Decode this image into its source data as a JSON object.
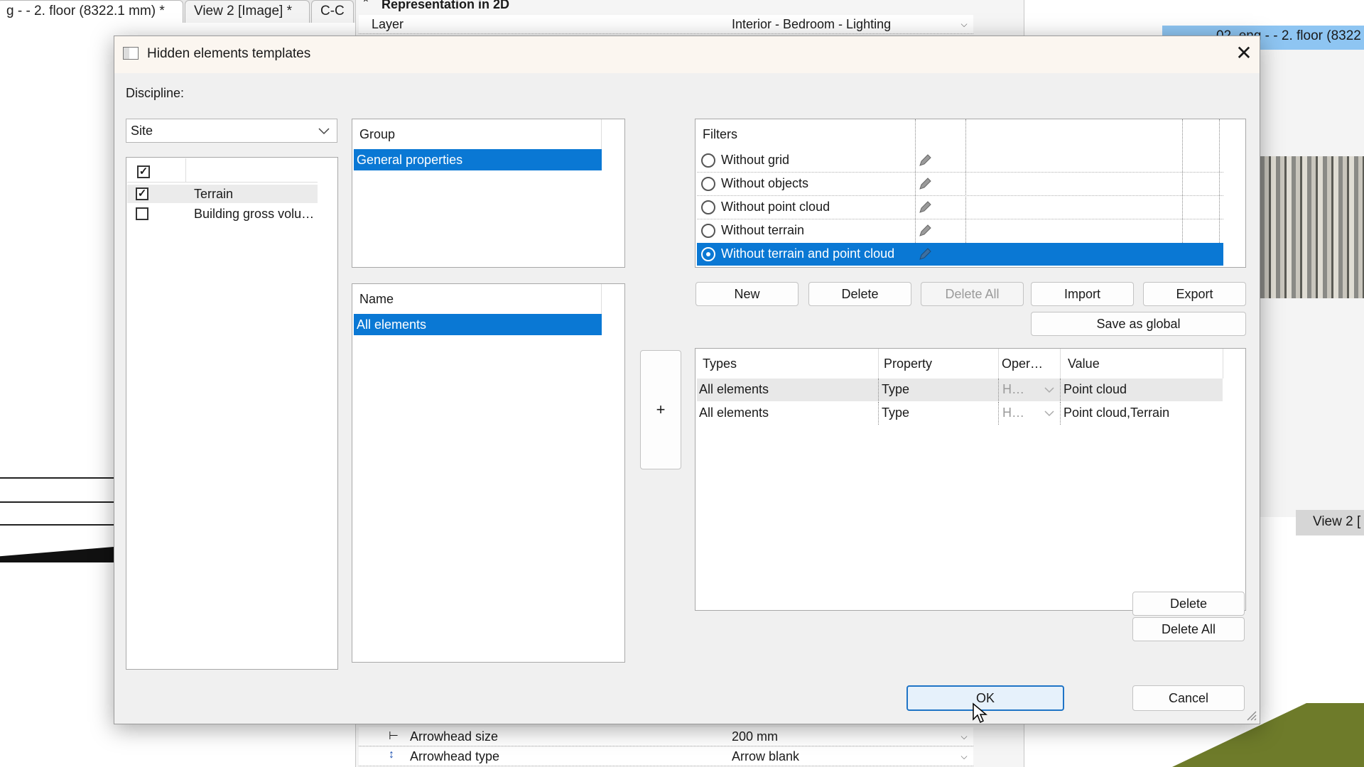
{
  "background": {
    "doc_tabs": [
      "g -  - 2. floor (8322.1 mm) *",
      "View 2 [Image] *",
      "C-C"
    ],
    "props_section_title": "Representation in 2D",
    "props_rows": [
      {
        "label": "Layer",
        "value": "Interior - Bedroom - Lighting"
      },
      {
        "label": "Arrowhead size",
        "value": "200 mm"
      },
      {
        "label": "Arrowhead type",
        "value": "Arrow blank"
      }
    ],
    "right_view_title": "02_eng -  - 2. floor (8322",
    "right_view2_tab": "View 2 ["
  },
  "dialog": {
    "title": "Hidden elements templates",
    "discipline_label": "Discipline:",
    "discipline_value": "Site",
    "element_list": [
      {
        "label": "Terrain",
        "checked": true
      },
      {
        "label": "Building gross volu…",
        "checked": false
      }
    ],
    "group_header": "Group",
    "groups": [
      "General properties"
    ],
    "name_header": "Name",
    "names": [
      "All elements"
    ],
    "plus_label": "+",
    "filters_header": "Filters",
    "filters": [
      {
        "label": "Without grid",
        "selected": false
      },
      {
        "label": "Without objects",
        "selected": false
      },
      {
        "label": "Without point cloud",
        "selected": false
      },
      {
        "label": "Without terrain",
        "selected": false
      },
      {
        "label": "Without terrain and point cloud",
        "selected": true
      }
    ],
    "buttons": {
      "new": "New",
      "delete": "Delete",
      "delete_all": "Delete All",
      "import": "Import",
      "export": "Export",
      "save_as_global": "Save as global",
      "rule_delete": "Delete",
      "rule_delete_all": "Delete All",
      "ok": "OK",
      "cancel": "Cancel"
    },
    "rules_table": {
      "columns": [
        "Types",
        "Property",
        "Oper…",
        "Value"
      ],
      "rows": [
        {
          "types": "All elements",
          "property": "Type",
          "operator": "H…",
          "value": "Point cloud"
        },
        {
          "types": "All elements",
          "property": "Type",
          "operator": "H…",
          "value": "Point cloud,Terrain"
        }
      ]
    }
  },
  "colors": {
    "selection": "#0a78d4",
    "ok_border": "#1f74c6",
    "dialog_bg": "#f0f0f0"
  }
}
